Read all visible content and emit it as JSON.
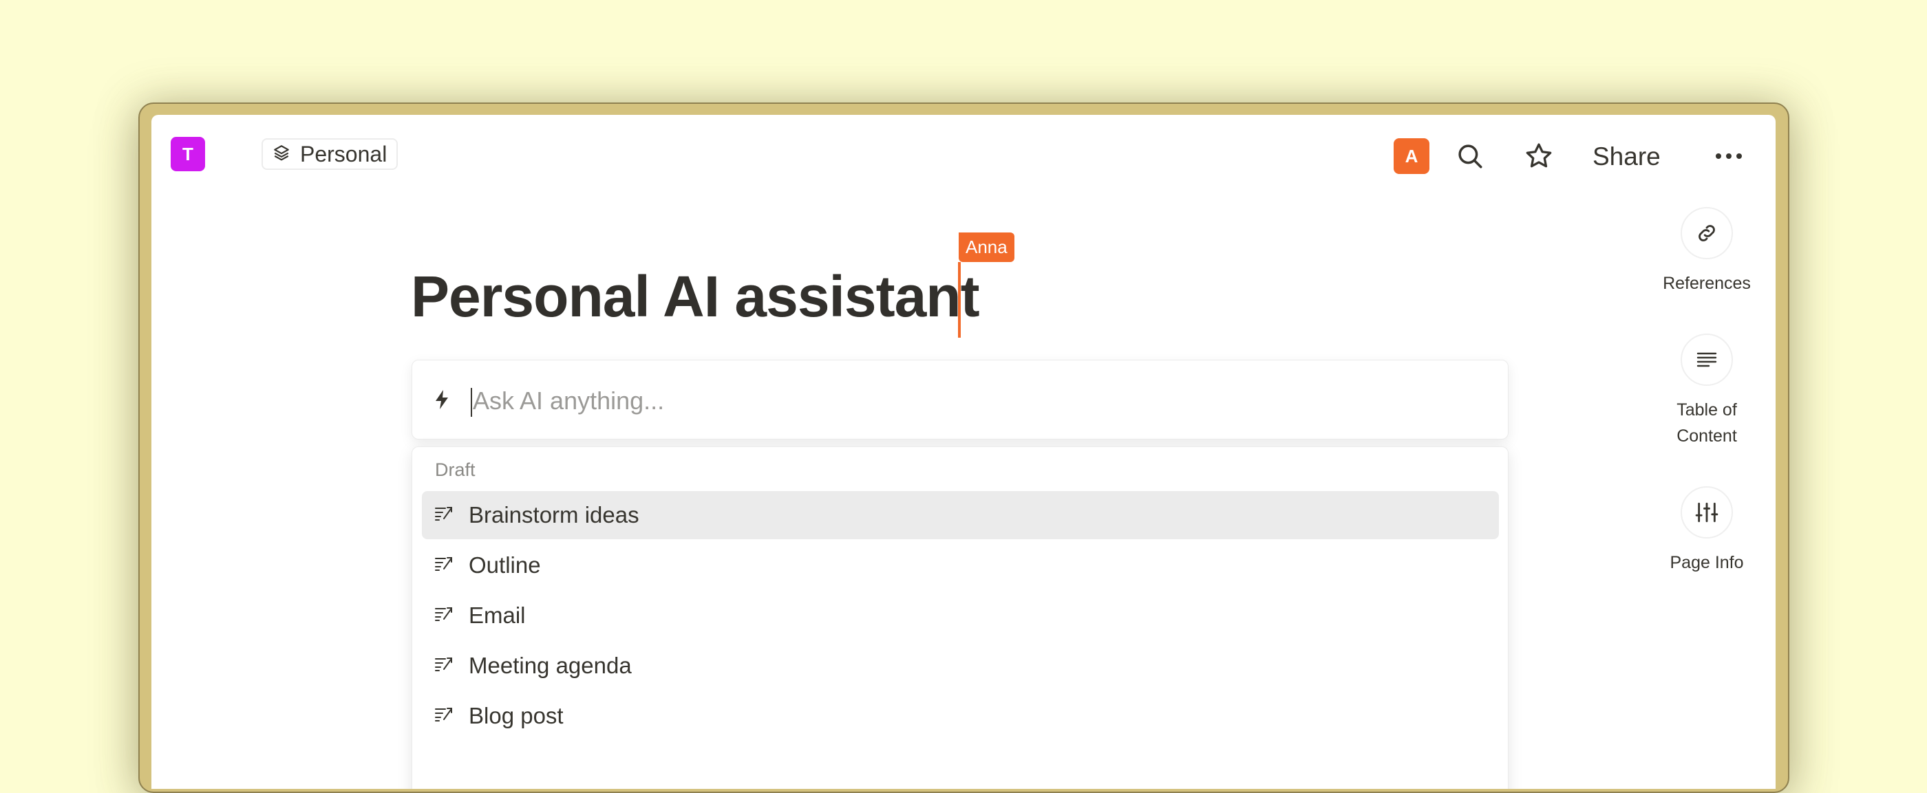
{
  "workspace": {
    "initial": "T",
    "color": "#d01bf0"
  },
  "breadcrumb": {
    "label": "Personal",
    "icon": "layers-icon"
  },
  "topbar": {
    "avatar_initial": "A",
    "avatar_color": "#f26a2a",
    "search_icon": "search-icon",
    "favorite_icon": "star-icon",
    "share_label": "Share",
    "more_icon": "more-horizontal-icon"
  },
  "page": {
    "title": "Personal AI assistant",
    "collaborator_cursor": {
      "name": "Anna",
      "color": "#f26a2a"
    }
  },
  "ask_ai": {
    "icon": "lightning-icon",
    "value": "",
    "placeholder": "Ask AI anything..."
  },
  "menu": {
    "section_label": "Draft",
    "items": [
      {
        "label": "Brainstorm ideas",
        "icon": "write-icon",
        "active": true
      },
      {
        "label": "Outline",
        "icon": "write-icon",
        "active": false
      },
      {
        "label": "Email",
        "icon": "write-icon",
        "active": false
      },
      {
        "label": "Meeting agenda",
        "icon": "write-icon",
        "active": false
      },
      {
        "label": "Blog post",
        "icon": "write-icon",
        "active": false
      }
    ]
  },
  "side_panel": [
    {
      "label": "References",
      "icon": "link-icon"
    },
    {
      "label": "Table of Content",
      "icon": "align-left-icon"
    },
    {
      "label": "Page Info",
      "icon": "sliders-icon"
    }
  ]
}
